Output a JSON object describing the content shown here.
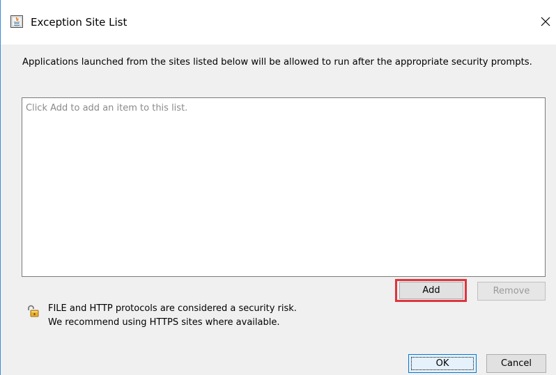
{
  "window": {
    "title": "Exception Site List",
    "title_icon": "java-icon",
    "close_glyph": "×"
  },
  "description": "Applications launched from the sites listed below will be allowed to run after the appropriate security prompts.",
  "site_list": {
    "placeholder": "Click Add to add an item to this list.",
    "items": []
  },
  "buttons": {
    "add_label": "Add",
    "remove_label": "Remove",
    "ok_label": "OK",
    "cancel_label": "Cancel"
  },
  "warning": {
    "icon": "lock-icon",
    "line1": "FILE and HTTP protocols are considered a security risk.",
    "line2": "We recommend using HTTPS sites where available."
  },
  "colors": {
    "highlight": "#e0343c",
    "focus_border": "#0078d7",
    "window_border": "#3a8ad8"
  }
}
